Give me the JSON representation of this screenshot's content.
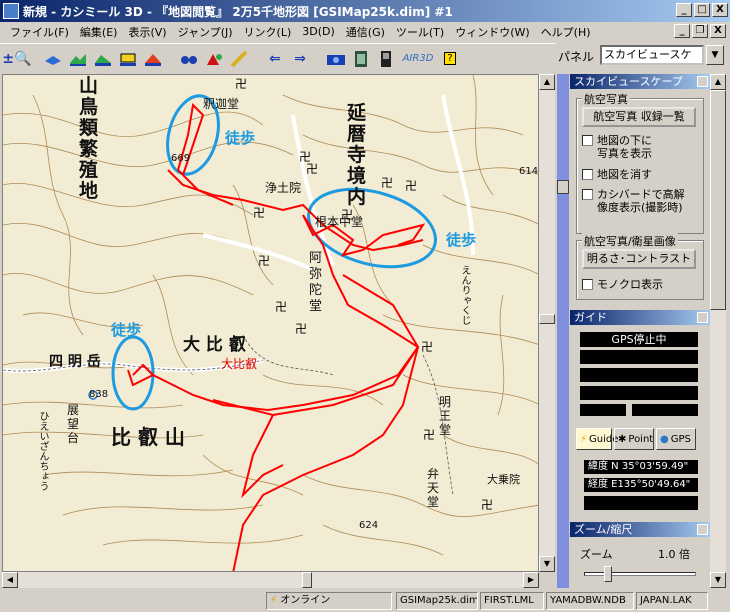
{
  "window": {
    "title": "新規 - カシミール 3D - 『地図閲覧』 2万5千地形図 [GSIMap25k.dim] #1",
    "controls": [
      "_",
      "□",
      "X"
    ]
  },
  "menu": [
    "ファイル(F)",
    "編集(E)",
    "表示(V)",
    "ジャンプ(J)",
    "リンク(L)",
    "3D(D)",
    "通信(G)",
    "ツール(T)",
    "ウィンドウ(W)",
    "ヘルプ(H)"
  ],
  "toolbar": {
    "icons": [
      "zoom-icon",
      "layer-icon",
      "terrain-view-icon",
      "terrain-a-icon",
      "terrain-b-icon",
      "terrain-c-icon",
      "binoculars-icon",
      "landmark-icon",
      "ruler-icon",
      "back-arrow-icon",
      "forward-arrow-icon",
      "camera-icon",
      "film-icon",
      "gps-device-icon",
      "help-icon"
    ]
  },
  "panel_selector": {
    "label": "パネル",
    "value": "スカイビュースケ"
  },
  "map": {
    "labels": {
      "yamatori_1": "山",
      "yamatori_2": "鳥",
      "yamatori_3": "類",
      "yamatori_4": "繁",
      "yamatori_5": "殖",
      "yamatori_6": "地",
      "enryaku_1": "延",
      "enryaku_2": "暦",
      "enryaku_3": "寺",
      "enryaku_4": "境",
      "enryaku_5": "内",
      "shakado": "釈迦堂",
      "jodoin": "浄土院",
      "konpon": "根本中堂",
      "amida_1": "阿",
      "amida_2": "弥",
      "amida_3": "陀",
      "amida_4": "堂",
      "daihiei": "大 比 叡",
      "daihiei_red": "大比叡",
      "shimeigatake": "四 明 岳",
      "hieizan": "比 叡 山",
      "tenbodai_1": "展",
      "tenbodai_2": "望",
      "tenbodai_3": "台",
      "myoodo_1": "明",
      "myoodo_2": "王",
      "myoodo_3": "堂",
      "benten_1": "弁",
      "benten_2": "天",
      "benten_3": "堂",
      "daijoin": "大乗院",
      "enryaku_hiragana": "えんりゃくじ",
      "hieizan_hiragana": "ひえいざんちょう",
      "elev_669": "669",
      "elev_838": "838",
      "elev_624": "624",
      "elev_614": "614",
      "toho_1": "徒歩",
      "toho_2": "徒歩",
      "toho_3": "徒歩"
    },
    "colors": {
      "background": "#f2ecd4",
      "contour": "#b08a55",
      "track": "#ff0000",
      "highlight": "#1e9be0",
      "road": "#ffffff",
      "symbol": "#000000"
    }
  },
  "right_panel": {
    "skyview_header": "スカイビュースケープ",
    "aerial_group": "航空写真",
    "aerial_list_button": "航空写真 収録一覧",
    "check_under_map": "地図の下に\n写真を表示",
    "check_hide_map": "地図を消す",
    "check_kashibird": "カシバードで高解\n像度表示(撮影時)",
    "satellite_group": "航空写真/衛星画像",
    "brightness_button": "明るさ･コントラスト",
    "check_mono": "モノクロ表示",
    "guide_header": "ガイド",
    "gps_status": "GPS停止中",
    "tab_guide": "Guide",
    "tab_point": "Point",
    "tab_gps": "GPS",
    "lat": "緯度  N 35°03'59.49\"",
    "lon": "経度  E135°50'49.64\"",
    "zoom_header": "ズーム/縮尺",
    "zoom_label": "ズーム",
    "zoom_value": "1.0 倍"
  },
  "status_bar": {
    "online": "オンライン",
    "cells": [
      "GSIMap25k.dim",
      "FIRST.LML",
      "YAMADBW.NDB",
      "JAPAN.LAK"
    ]
  }
}
